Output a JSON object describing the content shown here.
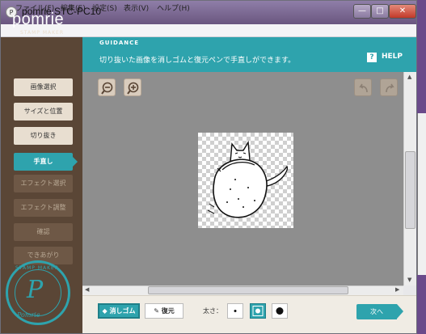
{
  "window": {
    "title": "pomrie STC-PC10",
    "app_icon": "pomrie-p-icon",
    "minimize": "—",
    "maximize": "□",
    "close": "✕"
  },
  "menu": [
    "ファイル(F)",
    "編集(E)",
    "設定(S)",
    "表示(V)",
    "ヘルプ(H)"
  ],
  "sidebar": {
    "logo": "pomrie",
    "logo_sub": "STAMP MAKER",
    "steps": [
      {
        "label": "画像選択",
        "state": "done"
      },
      {
        "label": "サイズと位置",
        "state": "done"
      },
      {
        "label": "切り抜き",
        "state": "done"
      },
      {
        "label": "手直し",
        "state": "current"
      },
      {
        "label": "エフェクト選択",
        "state": "upcoming"
      },
      {
        "label": "エフェクト調整",
        "state": "upcoming"
      },
      {
        "label": "確認",
        "state": "upcoming"
      },
      {
        "label": "できあがり",
        "state": "upcoming"
      }
    ],
    "seal": {
      "top": "STAMP MAKER",
      "letter": "P",
      "bottom": "Pomrie"
    }
  },
  "guidance": {
    "label": "GUIDANCE",
    "text": "切り抜いた画像を消しゴムと復元ペンで手直しができます。",
    "help_mark": "?",
    "help_label": "HELP"
  },
  "toolbar": {
    "zoom_out": "zoom-out-icon",
    "zoom_in": "zoom-in-icon",
    "undo": "undo-icon",
    "redo": "redo-icon"
  },
  "bottom": {
    "erase_label": "消しゴム",
    "restore_label": "復元",
    "thickness_label": "太さ：",
    "selected_size": "medium",
    "next_label": "次へ"
  },
  "colors": {
    "accent": "#2ea3ad",
    "sidebar": "#5a4636",
    "canvas": "#8e8e8e"
  }
}
